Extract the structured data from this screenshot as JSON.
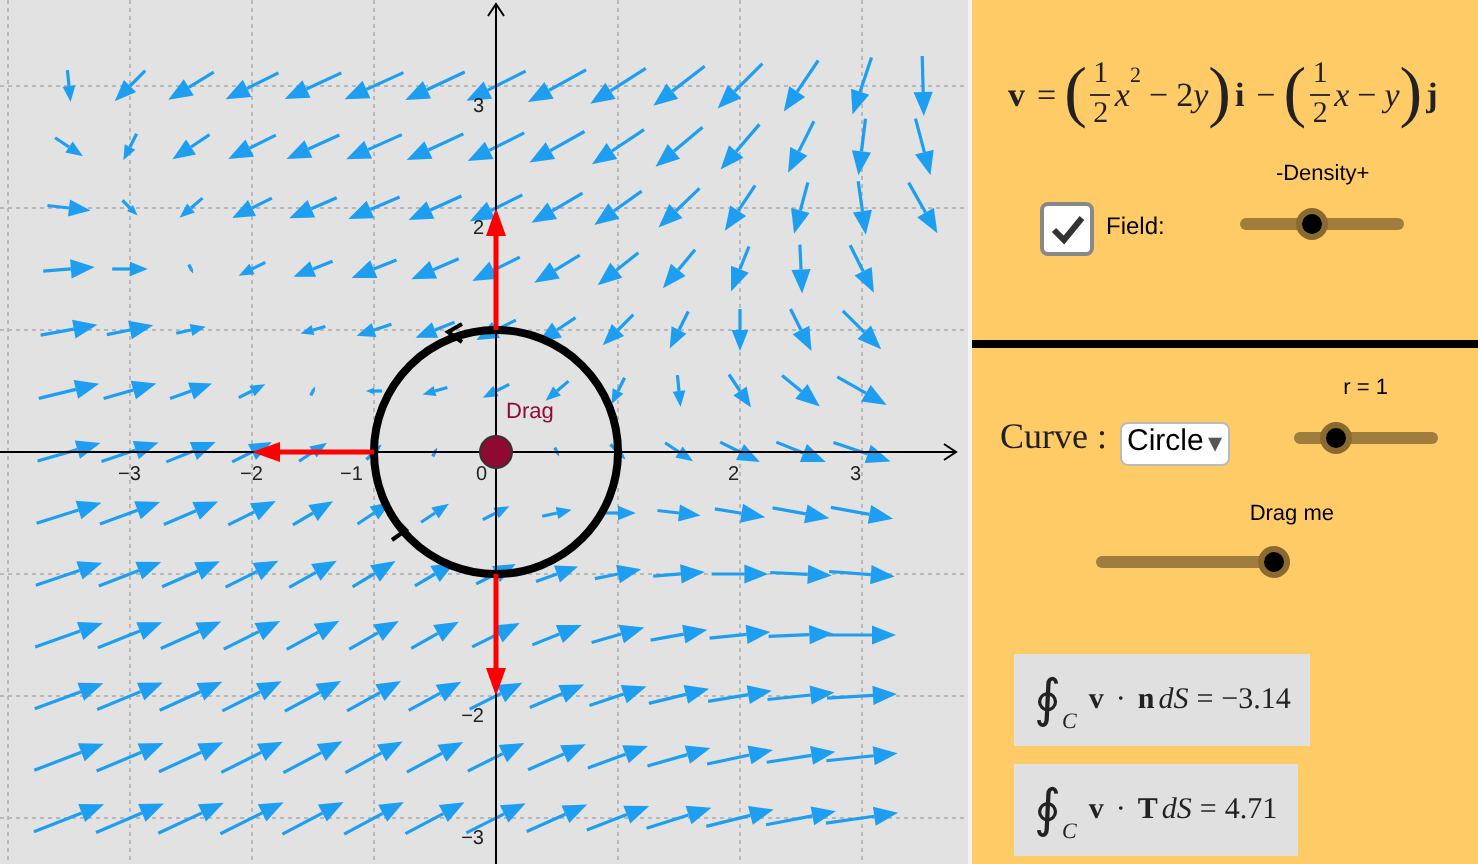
{
  "graph": {
    "x_tick_labels": [
      "−3",
      "−2",
      "−1",
      "0",
      "2",
      "3"
    ],
    "y_tick_labels": [
      "3",
      "2",
      "−2",
      "−3"
    ],
    "point_label": "Drag"
  },
  "field_formula": [
    {
      "kind": "bold",
      "text": "v"
    },
    {
      "kind": "op",
      "text": "="
    },
    {
      "kind": "paren",
      "text": "("
    },
    {
      "kind": "frac",
      "num": "1",
      "den": "2"
    },
    {
      "kind": "italic",
      "text": "x"
    },
    {
      "kind": "sup",
      "text": "2"
    },
    {
      "kind": "op",
      "text": "−"
    },
    {
      "kind": "plain",
      "text": "2"
    },
    {
      "kind": "italic",
      "text": "y"
    },
    {
      "kind": "paren",
      "text": ")"
    },
    {
      "kind": "bold",
      "text": "i"
    },
    {
      "kind": "op",
      "text": "−"
    },
    {
      "kind": "paren",
      "text": "("
    },
    {
      "kind": "frac",
      "num": "1",
      "den": "2"
    },
    {
      "kind": "italic",
      "text": "x"
    },
    {
      "kind": "op",
      "text": "−"
    },
    {
      "kind": "italic",
      "text": "y"
    },
    {
      "kind": "paren",
      "text": ")"
    },
    {
      "kind": "bold",
      "text": "j"
    }
  ],
  "field_toggle": {
    "label": "Field:",
    "checked": true
  },
  "density_slider": {
    "label": "-Density+",
    "level": 0.44
  },
  "curve": {
    "label": "Curve :",
    "value": "Circle",
    "caret": "▾"
  },
  "radius_slider": {
    "label": "r = 1",
    "level": 0.3
  },
  "drag_slider": {
    "label": "Drag me",
    "level": 0.92
  },
  "integrals": [
    {
      "sign": "∮",
      "sub": "C",
      "tokens": [
        {
          "kind": "bold",
          "text": "v"
        },
        {
          "kind": "op",
          "text": "·"
        },
        {
          "kind": "bold",
          "text": "n"
        },
        {
          "kind": "italic",
          "text": "dS"
        },
        {
          "kind": "op",
          "text": "="
        },
        {
          "kind": "plain",
          "text": "−3.14"
        }
      ]
    },
    {
      "sign": "∮",
      "sub": "C",
      "tokens": [
        {
          "kind": "bold",
          "text": "v"
        },
        {
          "kind": "op",
          "text": "·"
        },
        {
          "kind": "bold",
          "text": "T"
        },
        {
          "kind": "italic",
          "text": "dS"
        },
        {
          "kind": "op",
          "text": "="
        },
        {
          "kind": "plain",
          "text": "4.71"
        }
      ]
    }
  ]
}
